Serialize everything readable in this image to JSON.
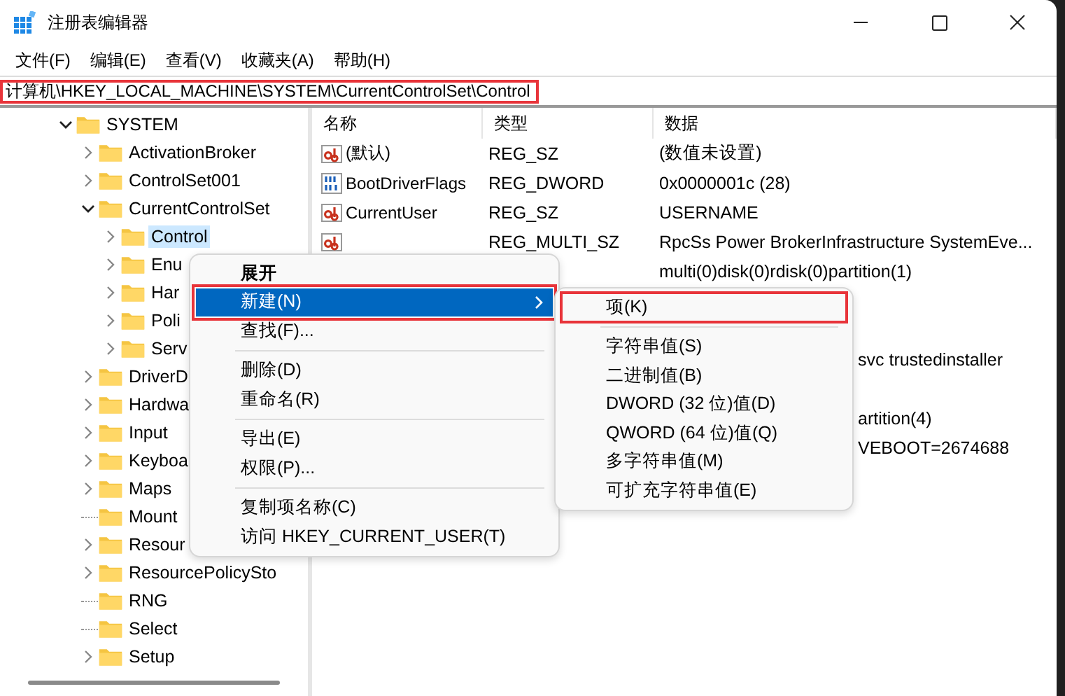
{
  "window": {
    "title": "注册表编辑器"
  },
  "menu_bar": [
    "文件(F)",
    "编辑(E)",
    "查看(V)",
    "收藏夹(A)",
    "帮助(H)"
  ],
  "address_bar": {
    "value": "计算机\\HKEY_LOCAL_MACHINE\\SYSTEM\\CurrentControlSet\\Control",
    "annotated": true
  },
  "tree": [
    {
      "label": "SYSTEM",
      "expanded": true,
      "selected": false,
      "children": [
        {
          "label": "ActivationBroker",
          "expanded": false,
          "selected": false
        },
        {
          "label": "ControlSet001",
          "expanded": false,
          "selected": false
        },
        {
          "label": "CurrentControlSet",
          "expanded": true,
          "selected": false,
          "children": [
            {
              "label": "Control",
              "expanded": false,
              "selected": true
            },
            {
              "label": "Enu",
              "expanded": false,
              "selected": false
            },
            {
              "label": "Har",
              "expanded": false,
              "selected": false
            },
            {
              "label": "Poli",
              "expanded": false,
              "selected": false
            },
            {
              "label": "Serv",
              "expanded": false,
              "selected": false
            }
          ]
        },
        {
          "label": "DriverD",
          "expanded": false,
          "selected": false
        },
        {
          "label": "Hardwa",
          "expanded": false,
          "selected": false
        },
        {
          "label": "Input",
          "expanded": false,
          "selected": false
        },
        {
          "label": "Keyboa",
          "expanded": false,
          "selected": false
        },
        {
          "label": "Maps",
          "expanded": false,
          "selected": false
        },
        {
          "label": "Mount",
          "selected": false,
          "leaf": true
        },
        {
          "label": "Resour",
          "expanded": false,
          "selected": false
        },
        {
          "label": "ResourcePolicySto",
          "expanded": false,
          "selected": false
        },
        {
          "label": "RNG",
          "selected": false,
          "leaf": true
        },
        {
          "label": "Select",
          "selected": false,
          "leaf": true
        },
        {
          "label": "Setup",
          "expanded": false,
          "selected": false
        }
      ]
    }
  ],
  "values_table": {
    "columns": [
      "名称",
      "类型",
      "数据"
    ],
    "rows": [
      {
        "kind": "string",
        "name": "(默认)",
        "type": "REG_SZ",
        "data": "(数值未设置)"
      },
      {
        "kind": "binary",
        "name": "BootDriverFlags",
        "type": "REG_DWORD",
        "data": "0x0000001c (28)"
      },
      {
        "kind": "string",
        "name": "CurrentUser",
        "type": "REG_SZ",
        "data": "USERNAME"
      },
      {
        "kind": "string",
        "type": "REG_MULTI_SZ",
        "data": "RpcSs Power BrokerInfrastructure SystemEve..."
      },
      {
        "kind": "plain",
        "data": "multi(0)disk(0)rdisk(0)partition(1)"
      },
      {
        "kind": "clipped",
        "data": "svc trustedinstaller"
      },
      {
        "kind": "clipped",
        "data": "artition(4)"
      },
      {
        "kind": "clipped",
        "data": "VEBOOT=2674688"
      }
    ]
  },
  "context_menu": {
    "items": [
      {
        "kind": "item",
        "label": "展开",
        "bold": true,
        "selected": false
      },
      {
        "kind": "submenu",
        "label": "新建(N)",
        "selected": true,
        "annotated": true
      },
      {
        "kind": "item",
        "label": "查找(F)...",
        "selected": false
      },
      {
        "kind": "separator"
      },
      {
        "kind": "item",
        "label": "删除(D)",
        "selected": false
      },
      {
        "kind": "item",
        "label": "重命名(R)",
        "selected": false
      },
      {
        "kind": "separator"
      },
      {
        "kind": "item",
        "label": "导出(E)",
        "selected": false
      },
      {
        "kind": "item",
        "label": "权限(P)...",
        "selected": false
      },
      {
        "kind": "separator"
      },
      {
        "kind": "item",
        "label": "复制项名称(C)",
        "selected": false
      },
      {
        "kind": "item",
        "label": "访问 HKEY_CURRENT_USER(T)",
        "selected": false
      }
    ]
  },
  "submenu": {
    "items": [
      {
        "kind": "item",
        "label": "项(K)",
        "selected": false,
        "annotated": true
      },
      {
        "kind": "separator"
      },
      {
        "kind": "item",
        "label": "字符串值(S)",
        "selected": false
      },
      {
        "kind": "item",
        "label": "二进制值(B)",
        "selected": false
      },
      {
        "kind": "item",
        "label": "DWORD (32 位)值(D)",
        "selected": false
      },
      {
        "kind": "item",
        "label": "QWORD (64 位)值(Q)",
        "selected": false
      },
      {
        "kind": "item",
        "label": "多字符串值(M)",
        "selected": false
      },
      {
        "kind": "item",
        "label": "可扩充字符串值(E)",
        "selected": false
      }
    ]
  }
}
